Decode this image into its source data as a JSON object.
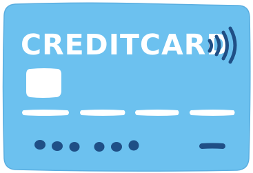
{
  "card": {
    "title": "CREDITCARD",
    "icons": {
      "chip": "chip-icon",
      "contactless": "contactless-icon"
    },
    "colors": {
      "card_fill": "#6cc1ef",
      "card_outline": "#5aaee0",
      "chip": "#ffffff",
      "stripe": "#ffffff",
      "dots": "#1f4f86",
      "contactless": "#1f4f86"
    },
    "number_groups": 4,
    "masked_digits": 6
  }
}
